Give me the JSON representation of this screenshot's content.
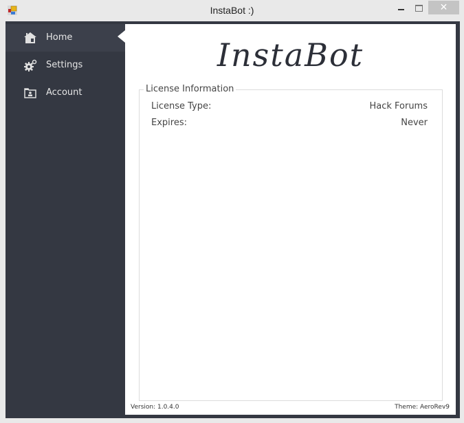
{
  "window": {
    "title": "InstaBot :)",
    "controls": {
      "minimize": "minimize",
      "maximize": "maximize",
      "close": "✕"
    }
  },
  "sidebar": {
    "items": [
      {
        "label": "Home",
        "icon": "home-icon",
        "active": true
      },
      {
        "label": "Settings",
        "icon": "gears-icon",
        "active": false
      },
      {
        "label": "Account",
        "icon": "account-folder-icon",
        "active": false
      }
    ]
  },
  "main": {
    "logo": "InstaBot",
    "license": {
      "title": "License Information",
      "rows": [
        {
          "label": "License Type:",
          "value": "Hack Forums"
        },
        {
          "label": "Expires:",
          "value": "Never"
        }
      ]
    },
    "footer": {
      "version": "Version: 1.0.4.0",
      "theme": "Theme: AeroRev9"
    }
  },
  "colors": {
    "sidebar_bg": "#343842",
    "sidebar_active": "#3c404b",
    "content_bg": "#ffffff",
    "window_bg": "#e9e9e9"
  }
}
